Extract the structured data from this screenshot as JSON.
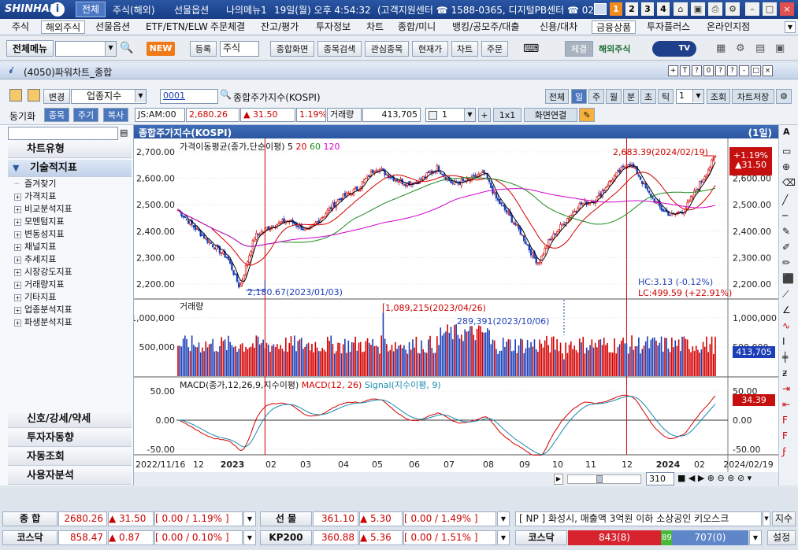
{
  "app": {
    "brand": "SHINHAN",
    "title_tabs": [
      "전체",
      "주식(해외)",
      "선물옵션",
      "나의메뉴1"
    ],
    "datetime": "19일(월) 오후 4:54:32",
    "contact": "(고객지원센터 ☎ 1588-0365, 디지털PB센터 ☎ 02",
    "screen_numbers": [
      "1",
      "2",
      "3",
      "4"
    ]
  },
  "menu": [
    "주식",
    "해외주식",
    "선물옵션",
    "ETF/ETN/ELW",
    "주문체결",
    "잔고/평가",
    "투자정보",
    "차트",
    "종합/미니",
    "뱅킹/공모주/대출",
    "신용/대차",
    "금융상품",
    "투자플러스",
    "온라인지점"
  ],
  "toolbar": {
    "all_menu": "전체메뉴",
    "new_badge": "NEW",
    "register": "등록",
    "stock": "주식",
    "buttons": [
      "종합화면",
      "종목검색",
      "관심종목",
      "현재가",
      "차트",
      "주문"
    ],
    "trade": "체결",
    "overseas": "해외주식",
    "tv": "TV"
  },
  "window": {
    "title": "(4050)파워차트_종합",
    "controls": [
      "+",
      "T",
      "?",
      "0",
      "?",
      "?",
      "-",
      "□",
      "×"
    ]
  },
  "controls": {
    "change": "변경",
    "index_type": "업종지수",
    "code": "0001",
    "code_name": "종합주가지수(KOSPI)",
    "periods": [
      "전체",
      "일",
      "주",
      "월",
      "분",
      "초",
      "틱"
    ],
    "period_count": "1",
    "query": "조회",
    "save": "차트저장",
    "sync": "동기화",
    "sync_tabs": [
      "종목",
      "주기",
      "복사"
    ],
    "market_time": "JS:AM:00",
    "price": "2,680.26",
    "change_val": "▲ 31.50",
    "change_pct": "1.19%",
    "volume_label": "거래량",
    "volume": "413,705",
    "count": "1",
    "layout": "1x1",
    "screen_link": "화면연결"
  },
  "left_panel": {
    "sections": [
      "차트유형",
      "기술적지표"
    ],
    "tree": [
      "즐겨찾기",
      "가격지표",
      "비교분석지표",
      "모멘텀지표",
      "변동성지표",
      "채널지표",
      "추세지표",
      "시장강도지표",
      "거래량지표",
      "기타지표",
      "업종분석지표",
      "파생분석지표"
    ],
    "bottom_sections": [
      "신호/강세/약세",
      "투자자동향",
      "자동조회",
      "사용자분석"
    ]
  },
  "chart": {
    "header_title": "종합주가지수(KOSPI)",
    "header_period": "(1일)",
    "price_legend": "가격이동평균(종가,단순이평)",
    "ma_periods": [
      "5",
      "20",
      "60",
      "120"
    ],
    "ma_colors": [
      "#000000",
      "#d40000",
      "#1a8a1a",
      "#d000d0"
    ],
    "volume_legend": "거래량",
    "macd_legend": "MACD(종가,12,26,9,지수이평)",
    "macd_line_label": "MACD(12, 26)",
    "signal_label": "Signal(지수이평, 9)",
    "annotations": {
      "high": "2,683.39(2024/02/19)",
      "low": "2,180.67(2023/01/03)",
      "vol_high": "1,089,215(2023/04/26)",
      "vol_mark": "289,391(2023/10/06)",
      "hc": "HC:3.13 (-0.12%)",
      "lc": "LC:499.59 (+22.91%)"
    },
    "price_axis": [
      "2,700.00",
      "2,600.00",
      "2,500.00",
      "2,400.00",
      "2,300.00",
      "2,200.00"
    ],
    "volume_axis": [
      "1,000,000",
      "500,000"
    ],
    "macd_axis": [
      "50.00",
      "0.00",
      "-50.00"
    ],
    "current_badge": {
      "pct": "+1.19%",
      "change": "▲31.50"
    },
    "volume_badge": "413,705",
    "macd_badge": "34.39",
    "x_axis": [
      "2022/11/16",
      "12",
      "2023",
      "02",
      "03",
      "04",
      "05",
      "06",
      "07",
      "08",
      "09",
      "10",
      "11",
      "12",
      "2024",
      "02",
      "2024/02/19"
    ],
    "scroll_count": "310"
  },
  "status": {
    "row1": {
      "l1": "종 합",
      "v1": "2680.26",
      "c1": "▲ 31.50",
      "p1": "[ 0.00 / 1.19% ]",
      "l2": "선 물",
      "v2": "361.10",
      "c2": "▲ 5.30",
      "p2": "[ 0.00 / 1.49% ]",
      "news": "[ NP ] 화성시, 매출액 3억원 이하 소상공인 키오스크",
      "btn": "지수"
    },
    "row2": {
      "l1": "코스닥",
      "v1": "858.47",
      "c1": "▲ 0.87",
      "p1": "[ 0.00 / 0.10% ]",
      "l2": "KP200",
      "v2": "360.88",
      "c2": "▲ 5.36",
      "p2": "[ 0.00 / 1.51% ]",
      "l3": "코스닥",
      "up": "843(8)",
      "flat": "89",
      "down": "707(0)",
      "btn": "설정"
    }
  }
}
